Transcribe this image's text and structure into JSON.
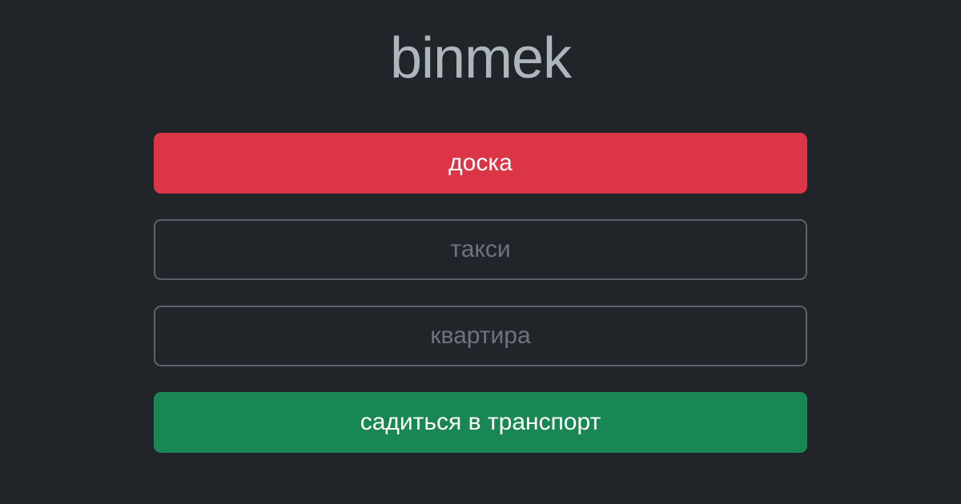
{
  "app": {
    "title": "binmek"
  },
  "form": {
    "board_label": "доска",
    "taxi_placeholder": "такси",
    "apartment_placeholder": "квартира",
    "submit_label": "садиться в транспорт"
  },
  "colors": {
    "background": "#212529",
    "title": "#adb5bd",
    "danger": "#dc3545",
    "success": "#198754",
    "input_border": "#5c636a",
    "placeholder": "#6c757d"
  }
}
